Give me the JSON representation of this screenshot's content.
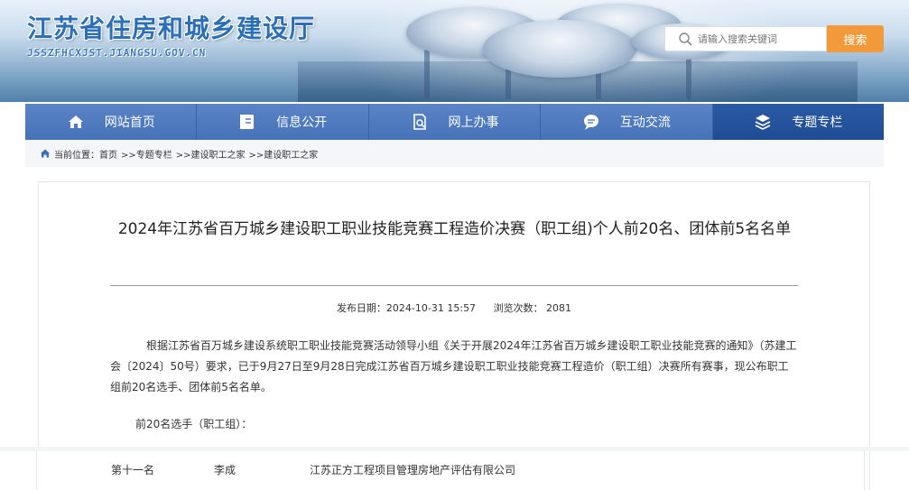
{
  "header": {
    "site_title": "江苏省住房和城乡建设厅",
    "site_url": "JSSZFHCXJST.JIANGSU.GOV.CN",
    "search_placeholder": "请输入搜索关键词",
    "search_button": "搜索"
  },
  "nav": {
    "items": [
      {
        "label": "网站首页",
        "icon": "home-icon"
      },
      {
        "label": "信息公开",
        "icon": "document-icon"
      },
      {
        "label": "网上办事",
        "icon": "search-doc-icon"
      },
      {
        "label": "互动交流",
        "icon": "chat-icon"
      },
      {
        "label": "专题专栏",
        "icon": "layers-icon"
      }
    ]
  },
  "breadcrumb": {
    "prefix": "当前位置：首页",
    "items": [
      ">>专题专栏",
      ">>建设职工之家",
      ">>建设职工之家"
    ]
  },
  "article": {
    "title": "2024年江苏省百万城乡建设职工职业技能竞赛工程造价决赛（职工组)个人前20名、团体前5名名单",
    "publish_label": "发布日期：2024-10-31 15:57",
    "views_label": "浏览次数： 2081",
    "paragraph": "根据江苏省百万城乡建设系统职工职业技能竞赛活动领导小组《关于开展2024年江苏省百万城乡建设职工职业技能竞赛的通知》（苏建工会〔2024〕50号）要求，已于9月27日至9月28日完成江苏省百万城乡建设职工职业技能竞赛工程造价（职工组）决赛所有赛事，现公布职工组前20名选手、团体前5名名单。",
    "subheading": "前20名选手（职工组）："
  },
  "table_row": {
    "rank": "第十一名",
    "name": "李成",
    "company": "江苏正方工程项目管理房地产评估有限公司"
  }
}
